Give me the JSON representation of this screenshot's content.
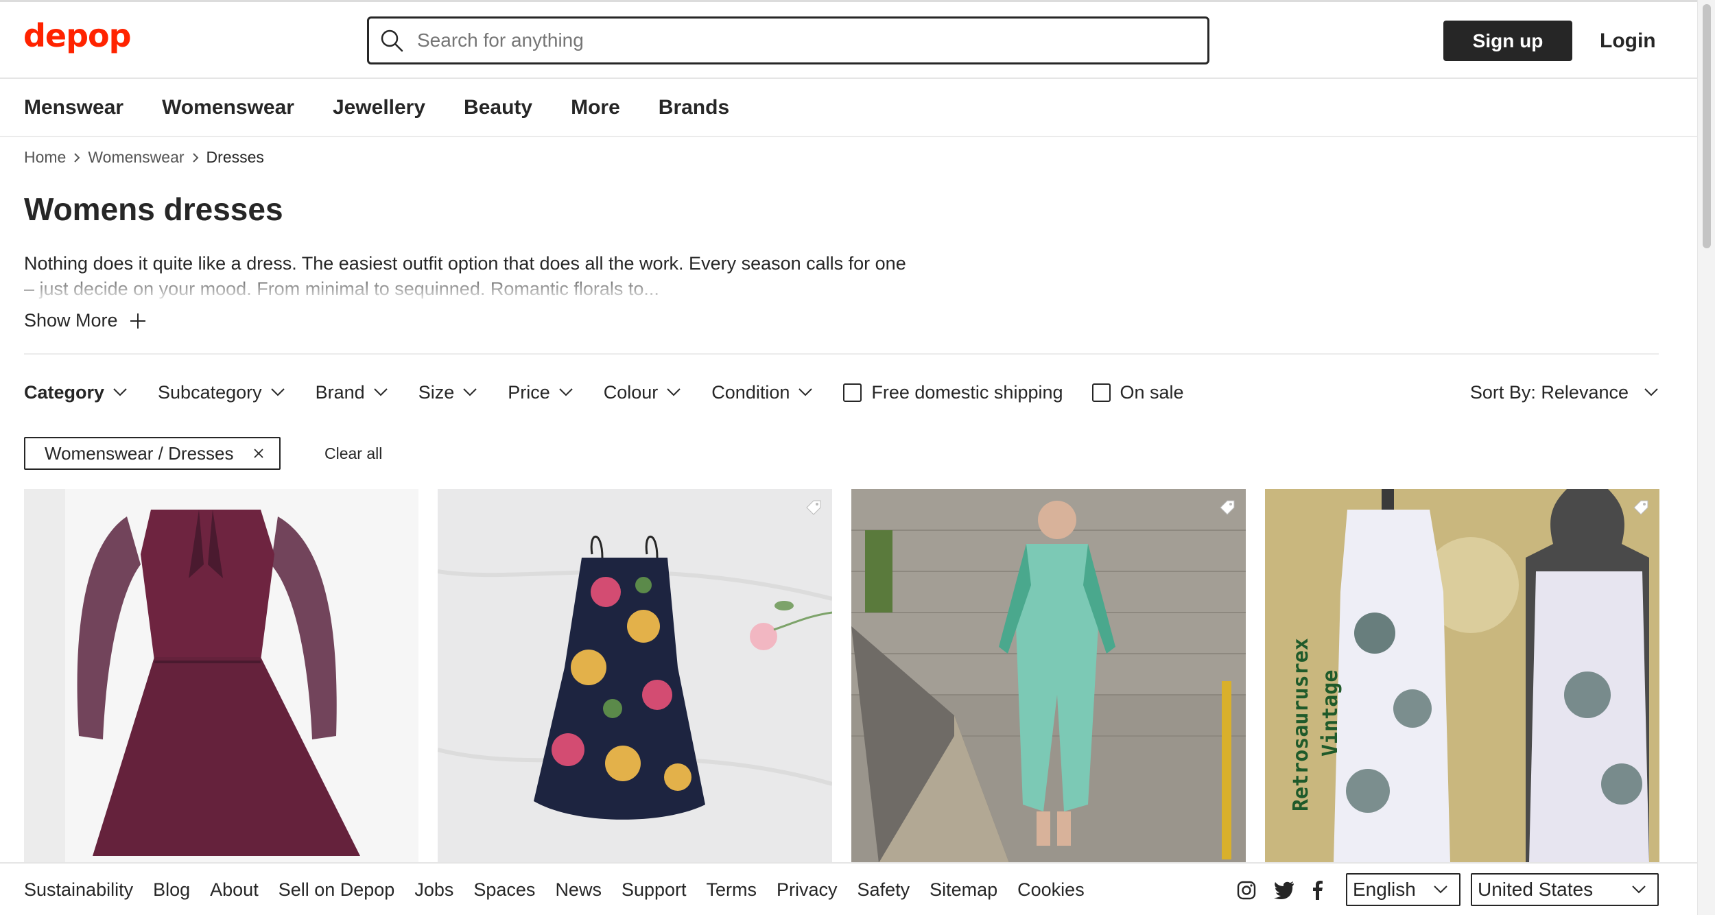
{
  "header": {
    "logo": "depop",
    "search_placeholder": "Search for anything",
    "signup_label": "Sign up",
    "login_label": "Login"
  },
  "nav": {
    "items": [
      "Menswear",
      "Womenswear",
      "Jewellery",
      "Beauty",
      "More",
      "Brands"
    ]
  },
  "breadcrumb": [
    "Home",
    "Womenswear",
    "Dresses"
  ],
  "page": {
    "title": "Womens dresses",
    "description": "Nothing does it quite like a dress. The easiest outfit option that does all the work. Every season calls for one – just decide on your mood. From minimal to sequinned. Romantic florals to...",
    "show_more_label": "Show More"
  },
  "filters": {
    "dropdowns": [
      "Category",
      "Subcategory",
      "Brand",
      "Size",
      "Price",
      "Colour",
      "Condition"
    ],
    "checkboxes": [
      "Free domestic shipping",
      "On sale"
    ],
    "sort_label": "Sort By: Relevance"
  },
  "active_filters": {
    "chips": [
      "Womenswear / Dresses"
    ],
    "clear_all_label": "Clear all"
  },
  "products": [
    {
      "description": "burgundy sheer-sleeve dress with neck bow",
      "has_tag_icon": false
    },
    {
      "description": "navy floral slip dress on white sheet",
      "has_tag_icon": true
    },
    {
      "description": "mint geometric-print maxi shirt dress",
      "has_tag_icon": true
    },
    {
      "description": "white floral print dresses on mannequins",
      "has_tag_icon": true,
      "overlay_text": "Retrosaurusrex Vintage"
    }
  ],
  "footer": {
    "links": [
      "Sustainability",
      "Blog",
      "About",
      "Sell on Depop",
      "Jobs",
      "Spaces",
      "News",
      "Support",
      "Terms",
      "Privacy",
      "Safety",
      "Sitemap",
      "Cookies"
    ],
    "socials": [
      "instagram-icon",
      "twitter-icon",
      "facebook-icon"
    ],
    "language": "English",
    "country": "United States"
  },
  "colors": {
    "brand": "#ff2300",
    "text": "#262626",
    "button_dark": "#262626"
  }
}
